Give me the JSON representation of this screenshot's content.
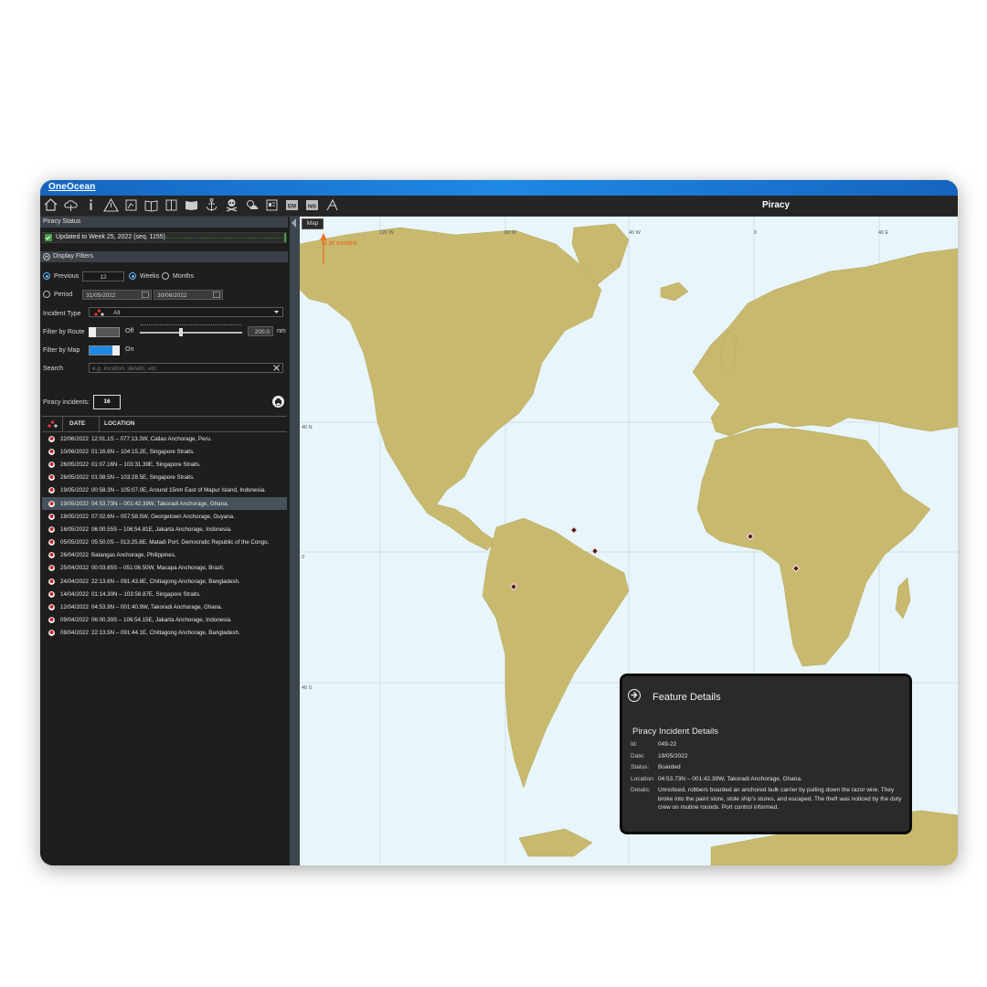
{
  "app": {
    "brand": "OneOcean",
    "page_title": "Piracy"
  },
  "toolbar": {
    "icons": [
      "home-icon",
      "cloud-download-icon",
      "info-icon",
      "warning-icon",
      "chart-icon",
      "open-book-icon",
      "book-icon",
      "library-icon",
      "anchor-icon",
      "skull-icon",
      "weather-icon",
      "document-icon",
      "em-icon",
      "ims-icon",
      "route-icon"
    ],
    "em_label": "EM",
    "ims_label": "IMS"
  },
  "status": {
    "header": "Piracy Status",
    "text": "Updated to Week 25, 2022 (seq. 1155)"
  },
  "filters": {
    "header": "Display Filters",
    "previous_label": "Previous",
    "previous_value": "12",
    "weeks_label": "Weeks",
    "months_label": "Months",
    "period_label": "Period",
    "date_from": "31/05/2022",
    "date_to": "30/06/2022",
    "incident_type_label": "Incident Type",
    "incident_type_value": "All",
    "filter_route_label": "Filter by Route",
    "filter_route_state": "Off",
    "route_distance": "200.0",
    "route_unit": "nm",
    "filter_map_label": "Filter by Map",
    "filter_map_state": "On",
    "search_label": "Search",
    "search_placeholder": "e.g. location, details, etc.",
    "accent_color": "#64b5f6"
  },
  "incidents": {
    "count_label": "Piracy incidents:",
    "count": "16",
    "col_date": "DATE",
    "col_location": "LOCATION",
    "rows": [
      {
        "date": "22/06/2022",
        "location": "12:01.1S – 077:13.3W, Callao Anchorage, Peru."
      },
      {
        "date": "10/06/2022",
        "location": "01:16.6N – 104:15.2E, Singapore Straits."
      },
      {
        "date": "26/05/2022",
        "location": "01:07.16N – 103:31.39E, Singapore Straits."
      },
      {
        "date": "26/05/2022",
        "location": "01:08.5N – 103:28.5E, Singapore Straits."
      },
      {
        "date": "19/05/2022",
        "location": "00:58.3N – 105:07.0E, Around 15nm East of Mapur Island, Indonesia."
      },
      {
        "date": "19/05/2022",
        "location": "04:53.73N – 001:42.39W, Takoradi Anchorage, Ghana."
      },
      {
        "date": "18/05/2022",
        "location": "07:02.6N – 057:58.5W, Georgetown Anchorage, Guyana."
      },
      {
        "date": "16/05/2022",
        "location": "06:00.55S – 106:54.81E, Jakarta Anchorage, Indonesia."
      },
      {
        "date": "05/05/2022",
        "location": "05:50.0S – 013:25.8E, Matadi Port, Democratic Republic of the Congo."
      },
      {
        "date": "26/04/2022",
        "location": "Batangas Anchorage, Philippines."
      },
      {
        "date": "25/04/2022",
        "location": "00:03.65S – 051:06.50W, Macapa Anchorage, Brazil."
      },
      {
        "date": "24/04/2022",
        "location": "22:13.6N – 091:43.8E, Chittagong Anchorage, Bangladesh."
      },
      {
        "date": "14/04/2022",
        "location": "01:14.30N – 103:58.87E, Singapore Straits."
      },
      {
        "date": "12/04/2022",
        "location": "04:53.9N – 001:40.9W, Takoradi Anchorage, Ghana."
      },
      {
        "date": "09/04/2022",
        "location": "06:00.39S – 106:54.15E, Jakarta Anchorage, Indonesia."
      },
      {
        "date": "08/04/2022",
        "location": "22:13.5N – 091:44.1E, Chittagong Anchorage, Bangladesh."
      }
    ],
    "selected_index": 5
  },
  "map": {
    "tab": "Map",
    "north_label": "N at centre",
    "lon_labels": [
      "120 W",
      "80 W",
      "40 W",
      "0",
      "40 E"
    ],
    "lat_labels": [
      "40 N",
      "0",
      "40 S"
    ],
    "land_color": "#c8b96e",
    "sea_color": "#e8f5fb"
  },
  "details": {
    "title": "Feature Details",
    "subtitle": "Piracy Incident Details",
    "id_label": "Id:",
    "id": "049-22",
    "date_label": "Date:",
    "date": "19/05/2022",
    "status_label": "Status:",
    "status": "Boarded",
    "location_label": "Location:",
    "location": "04:53.73N – 001:42.39W, Takoradi Anchorage, Ghana.",
    "details_label": "Details:",
    "details": "Unnoticed, robbers boarded an anchored bulk carrier by pulling down the razor wire. They broke into the paint store, stole ship's stores, and escaped. The theft was noticed by the duty crew on routine rounds. Port control informed."
  }
}
